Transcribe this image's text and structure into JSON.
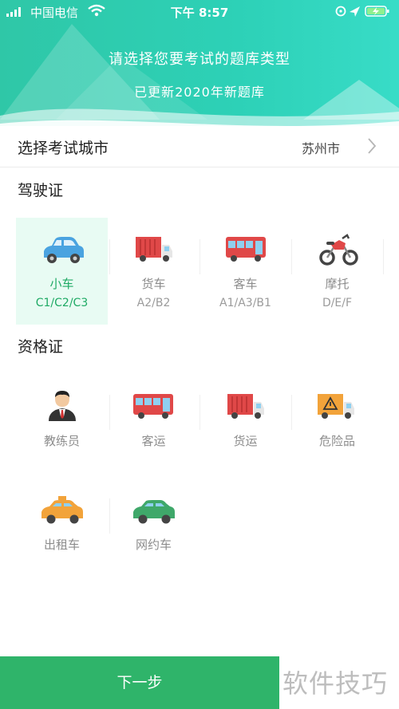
{
  "status_bar": {
    "carrier": "中国电信",
    "time": "下午 8:57"
  },
  "header": {
    "title": "请选择您要考试的题库类型",
    "subtitle": "已更新2020年新题库"
  },
  "city": {
    "label": "选择考试城市",
    "value": "苏州市"
  },
  "driving_section": {
    "title": "驾驶证",
    "items": [
      {
        "name": "小车",
        "code": "C1/C2/C3",
        "icon": "car-icon",
        "selected": true
      },
      {
        "name": "货车",
        "code": "A2/B2",
        "icon": "truck-icon",
        "selected": false
      },
      {
        "name": "客车",
        "code": "A1/A3/B1",
        "icon": "bus-icon",
        "selected": false
      },
      {
        "name": "摩托",
        "code": "D/E/F",
        "icon": "motorcycle-icon",
        "selected": false
      }
    ]
  },
  "qualification_section": {
    "title": "资格证",
    "items": [
      {
        "name": "教练员",
        "icon": "instructor-icon"
      },
      {
        "name": "客运",
        "icon": "bus-icon"
      },
      {
        "name": "货运",
        "icon": "truck-icon"
      },
      {
        "name": "危险品",
        "icon": "hazard-truck-icon"
      },
      {
        "name": "出租车",
        "icon": "taxi-icon"
      },
      {
        "name": "网约车",
        "icon": "ride-hailing-car-icon"
      }
    ]
  },
  "footer": {
    "next_label": "下一步"
  },
  "watermark": "软件技巧",
  "colors": {
    "accent": "#2fb46a",
    "header": "#2fc7a7",
    "selected_bg": "#e8fbf3"
  }
}
